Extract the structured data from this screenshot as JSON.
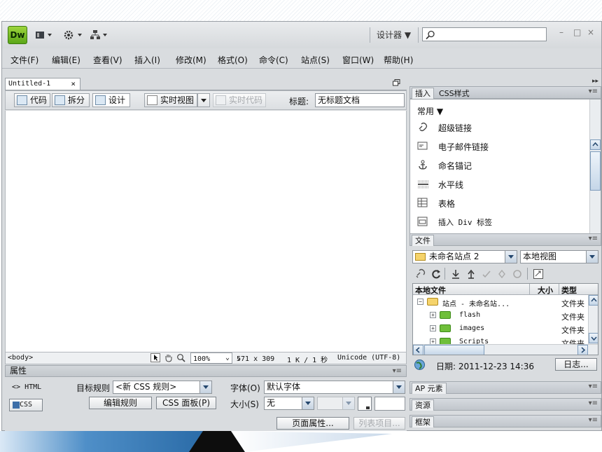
{
  "app": {
    "logo": "Dw",
    "title_icons": [
      "layout-icon",
      "gear-icon",
      "site-icon"
    ],
    "workspace": "设计器 ▼",
    "search_placeholder": "",
    "window_controls": [
      "–",
      "□",
      "×"
    ]
  },
  "menu": [
    "文件(F)",
    "编辑(E)",
    "查看(V)",
    "插入(I)",
    "修改(M)",
    "格式(O)",
    "命令(C)",
    "站点(S)",
    "窗口(W)",
    "帮助(H)"
  ],
  "document": {
    "tab": "Untitled-1",
    "tab_close": "×",
    "views": {
      "code": "代码",
      "split": "拆分",
      "design": "设计",
      "live_view": "实时视图",
      "live_code": "实时代码"
    },
    "title_label": "标题:",
    "title_value": "无标题文档"
  },
  "status": {
    "tag": "<body>",
    "zoom": "100%",
    "size": "571 x 309",
    "weight": "1 K / 1 秒",
    "encoding": "Unicode (UTF-8)"
  },
  "properties": {
    "panel_title": "属性",
    "html_btn": "HTML",
    "css_btn": "CSS",
    "target_rule_label": "目标规则",
    "target_rule_value": "<新 CSS 规则>",
    "edit_rule": "编辑规则",
    "css_panel": "CSS 面板(P)",
    "font_label": "字体(O)",
    "font_value": "默认字体",
    "size_label": "大小(S)",
    "size_value": "无",
    "page_props": "页面属性...",
    "list_item": "列表项目..."
  },
  "insert_panel": {
    "tabs": [
      "插入",
      "CSS样式"
    ],
    "category": "常用 ▼",
    "items": [
      "超级链接",
      "电子邮件链接",
      "命名锚记",
      "水平线",
      "表格",
      "插入 Div 标签"
    ]
  },
  "files_panel": {
    "tab": "文件",
    "site": "未命名站点 2",
    "view": "本地视图",
    "col_local": "本地文件",
    "col_size": "大小",
    "col_type": "类型",
    "rows": [
      {
        "name": "站点 - 未命名站...",
        "type": "文件夹"
      },
      {
        "name": "flash",
        "type": "文件夹"
      },
      {
        "name": "images",
        "type": "文件夹"
      },
      {
        "name": "Scripts",
        "type": "文件夹"
      }
    ],
    "date": "日期: 2011-12-23 14:36",
    "log_btn": "日志..."
  },
  "other_panels": [
    "AP 元素",
    "资源",
    "框架"
  ]
}
